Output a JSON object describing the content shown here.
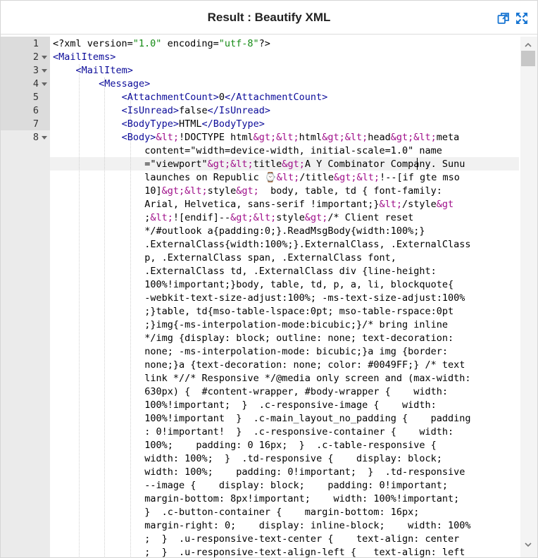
{
  "header": {
    "title": "Result : Beautify XML",
    "copy_icon": "copy-icon",
    "expand_icon": "fullscreen-icon",
    "accent_color": "#1976d2"
  },
  "gutter": {
    "line_numbers": [
      "1",
      "2",
      "3",
      "4",
      "5",
      "6",
      "7",
      "8"
    ],
    "foldable_lines": [
      "2",
      "3",
      "4",
      "8"
    ]
  },
  "code": {
    "lines": [
      [
        [
          "t",
          "<?xml version="
        ],
        [
          "s",
          "\"1.0\""
        ],
        [
          "t",
          " encoding="
        ],
        [
          "s",
          "\"utf-8\""
        ],
        [
          "t",
          "?>"
        ]
      ],
      [
        [
          "g",
          "<MailItems>"
        ]
      ],
      [
        [
          "g",
          "<MailItem>"
        ]
      ],
      [
        [
          "g",
          "<Message>"
        ]
      ],
      [
        [
          "g",
          "<AttachmentCount>"
        ],
        [
          "t",
          "0"
        ],
        [
          "g",
          "</AttachmentCount>"
        ]
      ],
      [
        [
          "g",
          "<IsUnread>"
        ],
        [
          "t",
          "false"
        ],
        [
          "g",
          "</IsUnread>"
        ]
      ],
      [
        [
          "g",
          "<BodyType>"
        ],
        [
          "t",
          "HTML"
        ],
        [
          "g",
          "</BodyType>"
        ]
      ],
      [
        [
          "g",
          "<Body>"
        ],
        [
          "e",
          "&lt;"
        ],
        [
          "t",
          "!DOCTYPE html"
        ],
        [
          "e",
          "&gt;&lt;"
        ],
        [
          "t",
          "html"
        ],
        [
          "e",
          "&gt;&lt;"
        ],
        [
          "t",
          "head"
        ],
        [
          "e",
          "&gt;&lt;"
        ],
        [
          "t",
          "meta"
        ]
      ],
      [
        [
          "t",
          "content=\"width=device-width, initial-scale=1.0\" name"
        ]
      ],
      [
        [
          "t",
          "=\"viewport\""
        ],
        [
          "e",
          "&gt;&lt;"
        ],
        [
          "t",
          "title"
        ],
        [
          "e",
          "&gt;"
        ],
        [
          "t",
          "A Y Combinator Company. Sunu"
        ]
      ],
      [
        [
          "t",
          "launches on Republic ⌚"
        ],
        [
          "e",
          "&lt;"
        ],
        [
          "t",
          "/title"
        ],
        [
          "e",
          "&gt;&lt;"
        ],
        [
          "t",
          "!--[if gte mso"
        ]
      ],
      [
        [
          "t",
          "10]"
        ],
        [
          "e",
          "&gt;&lt;"
        ],
        [
          "t",
          "style"
        ],
        [
          "e",
          "&gt;"
        ],
        [
          "t",
          "  body, table, td { font-family:"
        ]
      ],
      [
        [
          "t",
          "Arial, Helvetica, sans-serif !important;}"
        ],
        [
          "e",
          "&lt;"
        ],
        [
          "t",
          "/style"
        ],
        [
          "e",
          "&gt"
        ]
      ],
      [
        [
          "t",
          ";"
        ],
        [
          "e",
          "&lt;"
        ],
        [
          "t",
          "![endif]--"
        ],
        [
          "e",
          "&gt;&lt;"
        ],
        [
          "t",
          "style"
        ],
        [
          "e",
          "&gt;"
        ],
        [
          "t",
          "/* Client reset"
        ]
      ],
      [
        [
          "t",
          "*/#outlook a{padding:0;}.ReadMsgBody{width:100%;}"
        ]
      ],
      [
        [
          "t",
          ".ExternalClass{width:100%;}.ExternalClass, .ExternalClass"
        ]
      ],
      [
        [
          "t",
          "p, .ExternalClass span, .ExternalClass font,"
        ]
      ],
      [
        [
          "t",
          ".ExternalClass td, .ExternalClass div {line-height:"
        ]
      ],
      [
        [
          "t",
          "100%!important;}body, table, td, p, a, li, blockquote{"
        ]
      ],
      [
        [
          "t",
          "-webkit-text-size-adjust:100%; -ms-text-size-adjust:100%"
        ]
      ],
      [
        [
          "t",
          ";}table, td{mso-table-lspace:0pt; mso-table-rspace:0pt"
        ]
      ],
      [
        [
          "t",
          ";}img{-ms-interpolation-mode:bicubic;}/* bring inline"
        ]
      ],
      [
        [
          "t",
          "*/img {display: block; outline: none; text-decoration:"
        ]
      ],
      [
        [
          "t",
          "none; -ms-interpolation-mode: bicubic;}a img {border:"
        ]
      ],
      [
        [
          "t",
          "none;}a {text-decoration: none; color: #0049FF;} /* text"
        ]
      ],
      [
        [
          "t",
          "link *//* Responsive */@media only screen and (max-width:"
        ]
      ],
      [
        [
          "t",
          "630px) {  #content-wrapper, #body-wrapper {    width:"
        ]
      ],
      [
        [
          "t",
          "100%!important;  }  .c-responsive-image {    width:"
        ]
      ],
      [
        [
          "t",
          "100%!important  }  .c-main_layout_no_padding {    padding"
        ]
      ],
      [
        [
          "t",
          ": 0!important!  }  .c-responsive-container {    width:"
        ]
      ],
      [
        [
          "t",
          "100%;    padding: 0 16px;  }  .c-table-responsive {"
        ]
      ],
      [
        [
          "t",
          "width: 100%;  }  .td-responsive {    display: block;"
        ]
      ],
      [
        [
          "t",
          "width: 100%;    padding: 0!important;  }  .td-responsive"
        ]
      ],
      [
        [
          "t",
          "--image {    display: block;    padding: 0!important;"
        ]
      ],
      [
        [
          "t",
          "margin-bottom: 8px!important;    width: 100%!important;"
        ]
      ],
      [
        [
          "t",
          "}  .c-button-container {    margin-bottom: 16px;"
        ]
      ],
      [
        [
          "t",
          "margin-right: 0;    display: inline-block;    width: 100%"
        ]
      ],
      [
        [
          "t",
          ";  }  .u-responsive-text-center {    text-align: center"
        ]
      ],
      [
        [
          "t",
          ";  }  .u-responsive-text-align-left {   text-align: left"
        ]
      ]
    ]
  }
}
